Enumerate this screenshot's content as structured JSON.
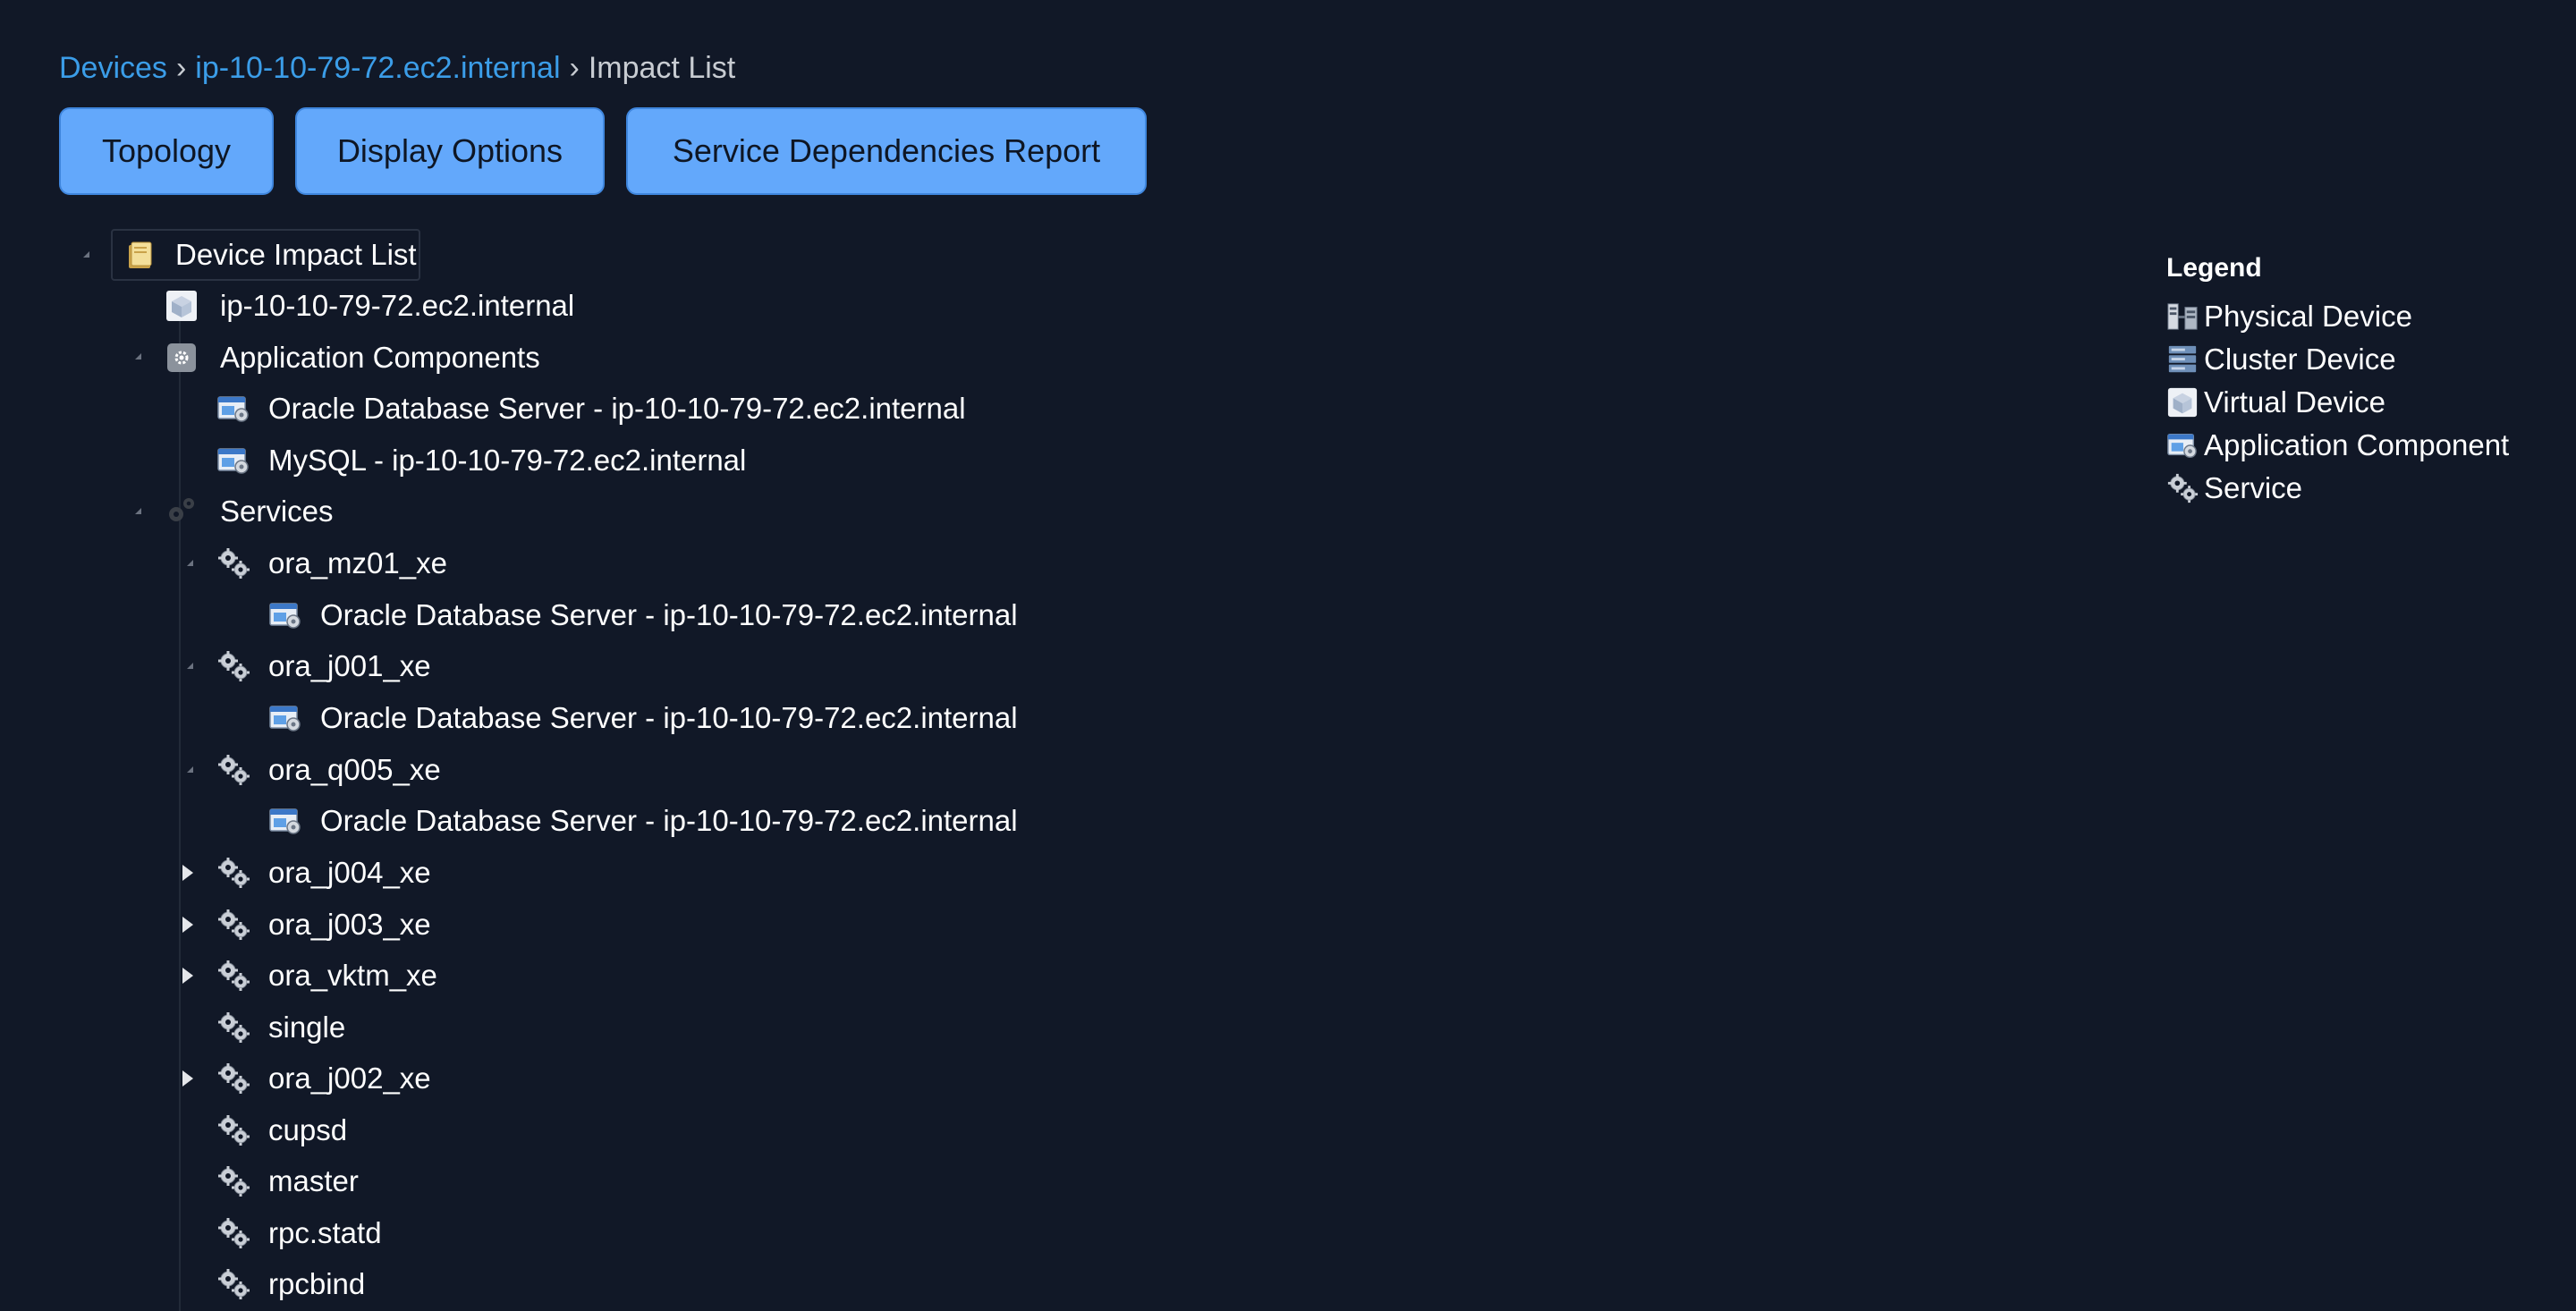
{
  "breadcrumb": {
    "items": [
      "Devices",
      "ip-10-10-79-72.ec2.internal"
    ],
    "separator": "›",
    "current": "Impact List"
  },
  "toolbar": {
    "topology_label": "Topology",
    "display_options_label": "Display Options",
    "service_report_label": "Service Dependencies Report"
  },
  "tree": {
    "root_label": "Device Impact List",
    "device_label": "ip-10-10-79-72.ec2.internal",
    "app_components_label": "Application Components",
    "app_components": [
      "Oracle Database Server - ip-10-10-79-72.ec2.internal",
      "MySQL - ip-10-10-79-72.ec2.internal"
    ],
    "services_label": "Services",
    "services": [
      {
        "name": "ora_mz01_xe",
        "state": "expanded",
        "child": "Oracle Database Server - ip-10-10-79-72.ec2.internal"
      },
      {
        "name": "ora_j001_xe",
        "state": "expanded",
        "child": "Oracle Database Server - ip-10-10-79-72.ec2.internal"
      },
      {
        "name": "ora_q005_xe",
        "state": "expanded",
        "child": "Oracle Database Server - ip-10-10-79-72.ec2.internal"
      },
      {
        "name": "ora_j004_xe",
        "state": "collapsed"
      },
      {
        "name": "ora_j003_xe",
        "state": "collapsed"
      },
      {
        "name": "ora_vktm_xe",
        "state": "collapsed"
      },
      {
        "name": "single",
        "state": "leaf"
      },
      {
        "name": "ora_j002_xe",
        "state": "collapsed"
      },
      {
        "name": "cupsd",
        "state": "leaf"
      },
      {
        "name": "master",
        "state": "leaf"
      },
      {
        "name": "rpc.statd",
        "state": "leaf"
      },
      {
        "name": "rpcbind",
        "state": "leaf"
      }
    ]
  },
  "legend": {
    "title": "Legend",
    "items": [
      {
        "label": "Physical Device",
        "icon": "physical-device-icon"
      },
      {
        "label": "Cluster Device",
        "icon": "cluster-device-icon"
      },
      {
        "label": "Virtual Device",
        "icon": "virtual-device-icon"
      },
      {
        "label": "Application Component",
        "icon": "application-component-icon"
      },
      {
        "label": "Service",
        "icon": "service-icon"
      }
    ]
  },
  "colors": {
    "background": "#111827",
    "link": "#3b9de8",
    "button": "#63a8fb",
    "text": "#ffffff"
  }
}
